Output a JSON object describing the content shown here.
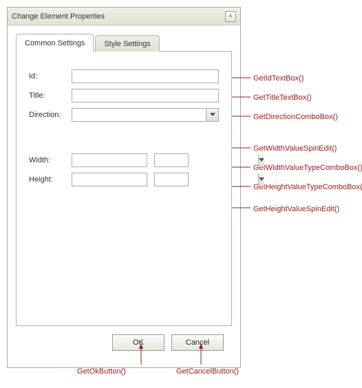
{
  "dialog": {
    "title": "Change Element Properties",
    "close_icon": "×"
  },
  "tabs": {
    "common": "Common Settings",
    "style": "Style Settings"
  },
  "labels": {
    "id": "Id:",
    "title": "Title:",
    "direction": "Direction:",
    "width": "Width:",
    "height": "Height:"
  },
  "buttons": {
    "ok": "OK",
    "cancel": "Cancel"
  },
  "values": {
    "id": "",
    "title": "",
    "direction": "",
    "width": "",
    "widthType": "",
    "height": "",
    "heightType": ""
  },
  "annotations": {
    "idTextBox": "GetIdTextBox()",
    "titleTextBox": "GetTitleTextBox()",
    "directionCombo": "GetDirectionComboBox()",
    "widthSpin": "GetWidthValueSpinEdit()",
    "widthTypeCombo": "GetWidthValueTypeComboBox()",
    "heightTypeCombo": "GetHeightValueTypeComboBox()",
    "heightSpin": "GetHeightValueSpinEdit()",
    "okButton": "GetOkButton()",
    "cancelButton": "GetCancelButton()"
  },
  "colors": {
    "annotation": "#9a1b1b"
  }
}
